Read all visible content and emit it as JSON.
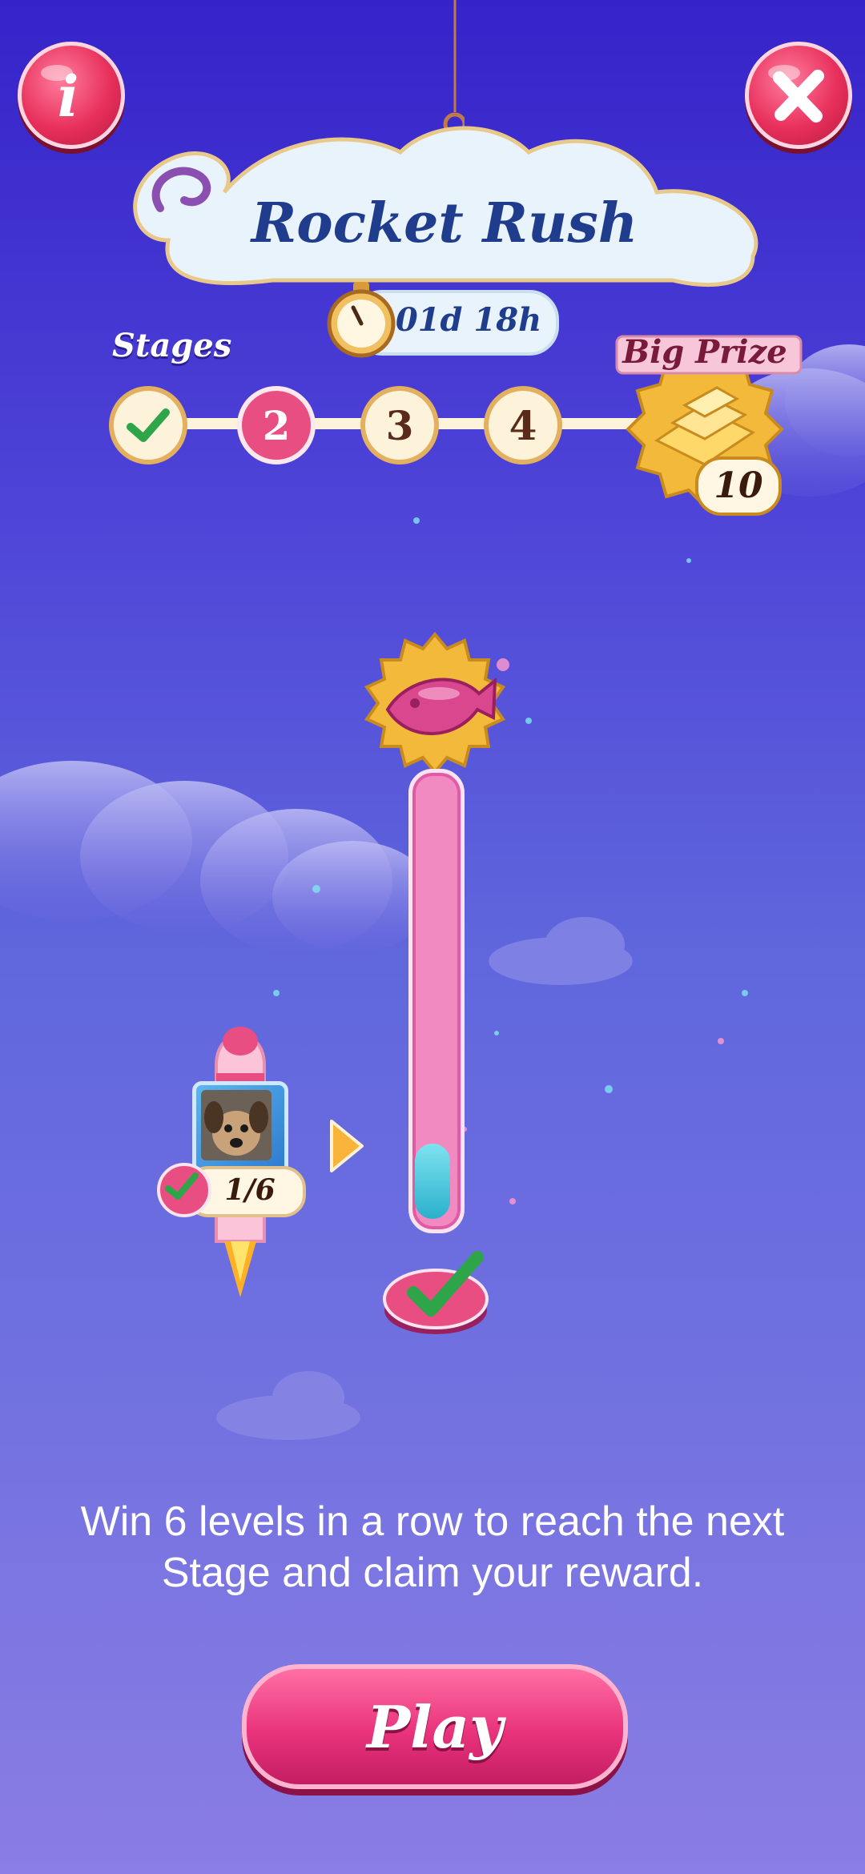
{
  "header": {
    "title": "Rocket Rush",
    "timer": "01d 18h",
    "stages_label": "Stages",
    "big_prize_label": "Big Prize",
    "big_prize_count": "10"
  },
  "stages": {
    "completed": "1",
    "current": "2",
    "items": [
      "2",
      "3",
      "4"
    ]
  },
  "progress": {
    "player_count": "1/6",
    "fill_fraction": 0.17
  },
  "description": "Win 6 levels in a row to reach the next Stage and claim your reward.",
  "play_label": "Play",
  "colors": {
    "accent_pink": "#e9337b",
    "bg_top": "#3523c9",
    "bg_bottom": "#8a7de3",
    "gold": "#f3b93a",
    "tube_fill": "#43c6de"
  },
  "icons": {
    "info": "info-icon",
    "close": "close-icon",
    "timer": "stopwatch-icon",
    "prize": "gold-bars-icon",
    "reward": "fish-candy-icon",
    "check": "checkmark-icon",
    "arrow": "arrow-right-icon"
  }
}
